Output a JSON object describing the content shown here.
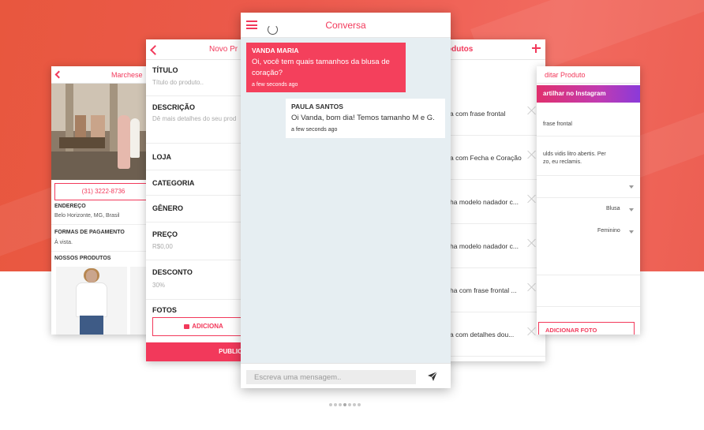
{
  "screen_store": {
    "title": "Marchese",
    "phone": "(31) 3222-8736",
    "address_label": "ENDEREÇO",
    "address_value": "Belo Horizonte, MG, Brasil",
    "payment_label": "FORMAS DE PAGAMENTO",
    "payment_value": "À vista.",
    "products_label": "NOSSOS PRODUTOS"
  },
  "screen_new_product": {
    "title": "Novo Pr",
    "fields": [
      {
        "label": "TÍTULO",
        "placeholder": "Título do produto.."
      },
      {
        "label": "DESCRIÇÃO",
        "placeholder": "Dê mais detalhes do seu prod"
      },
      {
        "label": "LOJA",
        "placeholder": ""
      },
      {
        "label": "CATEGORIA",
        "placeholder": ""
      },
      {
        "label": "GÊNERO",
        "placeholder": ""
      },
      {
        "label": "PREÇO",
        "placeholder": "R$0,00"
      },
      {
        "label": "DESCONTO",
        "placeholder": "30%"
      },
      {
        "label": "FOTOS",
        "placeholder": ""
      }
    ],
    "add_photo_label": "ADICIONA",
    "publish_label": "PUBLIC"
  },
  "screen_chat": {
    "title": "Conversa",
    "messages": [
      {
        "sender": "VANDA MARIA",
        "text": "Oi, você tem quais tamanhos da blusa de coração?",
        "time": "a few seconds ago"
      },
      {
        "sender": "PAULA SANTOS",
        "text": "Oi Vanda, bom dia! Temos tamanho M e G.",
        "time": "a few seconds ago"
      }
    ],
    "composer_placeholder": "Escreva uma mensagem.."
  },
  "screen_products": {
    "title": "odutos",
    "items": [
      "a com frase frontal",
      "a com Fecha e Coração",
      "ha modelo nadador c...",
      "ha modelo nadador c...",
      "ha com frase frontal ...",
      "a com detalhes dou..."
    ]
  },
  "screen_edit_product": {
    "title": "ditar Produto",
    "instagram_label": "artilhar no Instagram",
    "title_value": "frase frontal",
    "desc_line1": "ulds vidis litro abertis. Per",
    "desc_line2": "zo, eu reclamis.",
    "category_value": "Blusa",
    "gender_value": "Feminino",
    "add_photo_label": "ADICIONAR FOTO"
  },
  "colors": {
    "accent": "#f2395b",
    "hero": "#ec5a4d",
    "chat_bg": "#e6eef2"
  },
  "pager": {
    "count": 7,
    "active": 3
  }
}
